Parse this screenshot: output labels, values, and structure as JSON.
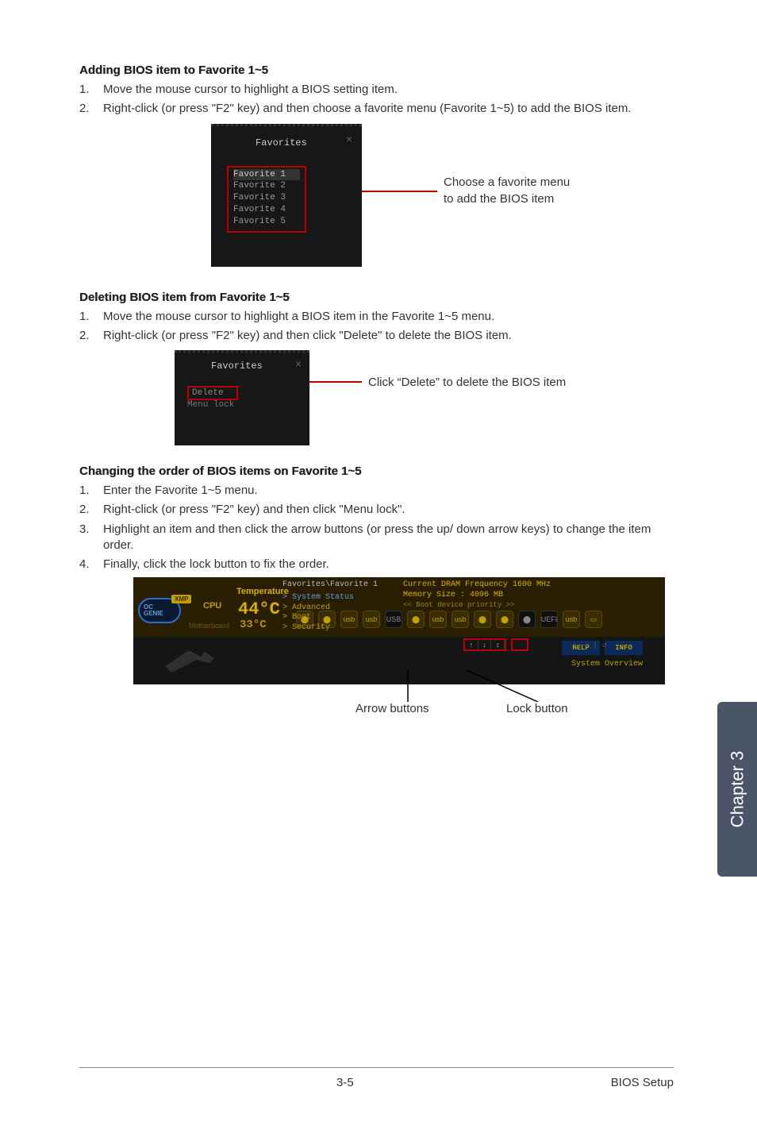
{
  "sections": {
    "s1": {
      "head": "Adding BIOS item to Favorite 1~5",
      "items": [
        "Move the mouse cursor to highlight a BIOS setting item.",
        "Right-click (or press \"F2\" key) and then choose a favorite menu (Favorite 1~5) to add the BIOS item."
      ]
    },
    "s2": {
      "head": "Deleting BIOS item from Favorite 1~5",
      "items": [
        "Move the mouse cursor to highlight a BIOS item in the Favorite 1~5 menu.",
        "Right-click (or press \"F2\" key) and then click \"Delete\" to delete the BIOS item."
      ]
    },
    "s3": {
      "head": "Changing the order of BIOS items on Favorite 1~5",
      "items": [
        "Enter the Favorite 1~5 menu.",
        "Right-click (or press \"F2\" key) and then click \"Menu lock\".",
        "Highlight an item and then click the arrow buttons (or press the up/ down arrow keys) to change the item order.",
        "Finally, click the lock button to fix the order."
      ]
    }
  },
  "fig1": {
    "title": "Favorites",
    "opts": [
      "Favorite 1",
      "Favorite 2",
      "Favorite 3",
      "Favorite 4",
      "Favorite 5"
    ],
    "note_l1": "Choose a favorite menu",
    "note_l2": "to add the BIOS item"
  },
  "fig2": {
    "title": "Favorites",
    "delete": "Delete",
    "lock": "Menu lock",
    "note": "Click “Delete” to delete the BIOS item"
  },
  "fig3": {
    "genie": "OC\nGENIE",
    "xmp": "XMP",
    "cpu": "CPU",
    "temp_label": "Temperature",
    "temp_big": "44°C",
    "temp_sm": "33°C",
    "mb": "Motherboard",
    "dram": "Current DRAM Frequency 1600 MHz",
    "mem": "Memory Size : 4096 MB",
    "boot": "<< Boot device priority >>",
    "fav_path": "Favorites\\Favorite 1",
    "menu": {
      "m1": "> System Status",
      "m2": "> Advanced",
      "m3": "> Boot",
      "m4": "> Security"
    },
    "help": "HELP",
    "info": "INFO",
    "sysov": "System Overview",
    "undo": "⇤ ⇥ | ↺",
    "arrow_label": "Arrow buttons",
    "lock_label": "Lock button"
  },
  "chapter": "Chapter 3",
  "footer": {
    "page": "3-5",
    "title": "BIOS Setup"
  }
}
